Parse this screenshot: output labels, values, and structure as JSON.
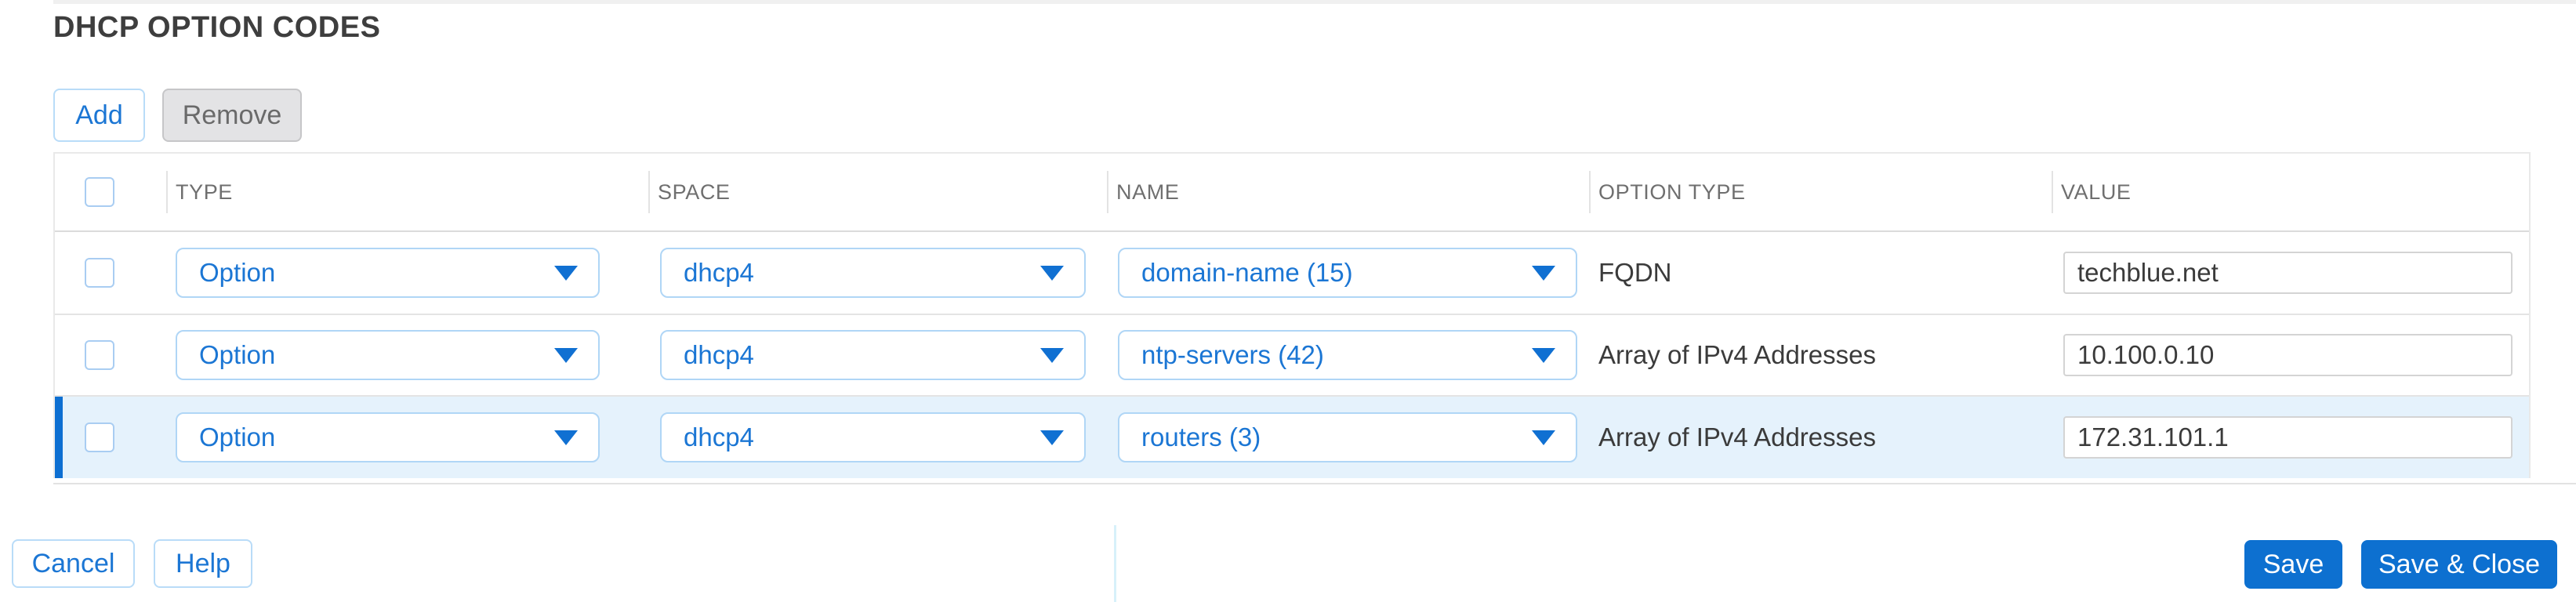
{
  "title": "DHCP OPTION CODES",
  "toolbar": {
    "add_label": "Add",
    "remove_label": "Remove"
  },
  "table": {
    "columns": [
      "TYPE",
      "SPACE",
      "NAME",
      "OPTION TYPE",
      "VALUE"
    ],
    "rows": [
      {
        "type": "Option",
        "space": "dhcp4",
        "name": "domain-name (15)",
        "option_type": "FQDN",
        "value": "techblue.net",
        "selected": false
      },
      {
        "type": "Option",
        "space": "dhcp4",
        "name": "ntp-servers (42)",
        "option_type": "Array of IPv4 Addresses",
        "value": "10.100.0.10",
        "selected": false
      },
      {
        "type": "Option",
        "space": "dhcp4",
        "name": "routers (3)",
        "option_type": "Array of IPv4 Addresses",
        "value": "172.31.101.1",
        "selected": true
      }
    ]
  },
  "footer": {
    "cancel_label": "Cancel",
    "help_label": "Help",
    "save_label": "Save",
    "save_close_label": "Save & Close"
  },
  "colors": {
    "accent_blue": "#0d70d0",
    "link_blue": "#1b76d4",
    "light_blue_border": "#b0d6f6",
    "selected_row_bg": "#e5f2fc",
    "selected_row_bar": "#0d6fd2",
    "disabled_gray_bg": "#e3e3e5"
  }
}
